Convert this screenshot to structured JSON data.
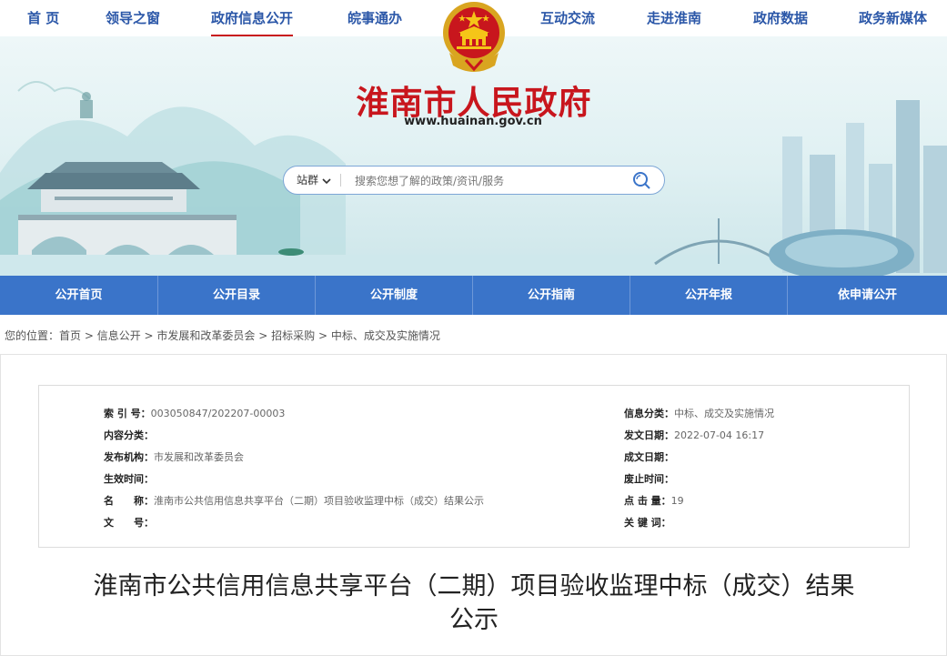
{
  "top_nav": {
    "items": [
      "首 页",
      "领导之窗",
      "政府信息公开",
      "皖事通办",
      "互动交流",
      "走进淮南",
      "政府数据",
      "政务新媒体"
    ],
    "active_index": 2
  },
  "banner": {
    "site_title": "淮南市人民政府",
    "site_url": "www.huainan.gov.cn",
    "search": {
      "scope_label": "站群",
      "placeholder": "搜索您想了解的政策/资讯/服务"
    }
  },
  "sub_nav": {
    "items": [
      "公开首页",
      "公开目录",
      "公开制度",
      "公开指南",
      "公开年报",
      "依申请公开"
    ]
  },
  "breadcrumb": {
    "prefix": "您的位置：",
    "items": [
      "首页",
      "信息公开",
      "市发展和改革委员会",
      "招标采购",
      "中标、成交及实施情况"
    ]
  },
  "metadata": {
    "left": [
      {
        "label": "索 引 号：",
        "value": "003050847/202207-00003"
      },
      {
        "label": "内容分类：",
        "value": ""
      },
      {
        "label": "发布机构：",
        "value": "市发展和改革委员会"
      },
      {
        "label": "生效时间：",
        "value": ""
      },
      {
        "label": "名　　称：",
        "value": "淮南市公共信用信息共享平台（二期）项目验收监理中标（成交）结果公示"
      },
      {
        "label": "文　　号：",
        "value": ""
      }
    ],
    "right": [
      {
        "label": "信息分类：",
        "value": "中标、成交及实施情况"
      },
      {
        "label": "发文日期：",
        "value": "2022-07-04 16:17"
      },
      {
        "label": "成文日期：",
        "value": ""
      },
      {
        "label": "废止时间：",
        "value": ""
      },
      {
        "label": "点 击 量：",
        "value": "19"
      },
      {
        "label": "关 键 词：",
        "value": ""
      }
    ]
  },
  "article": {
    "title_line1": "淮南市公共信用信息共享平台（二期）项目验收监理中标（成交）结果",
    "title_line2": "公示"
  },
  "colors": {
    "nav_text": "#2b57a8",
    "accent_red": "#c8161d",
    "subnav_bg": "#3a74c9"
  }
}
